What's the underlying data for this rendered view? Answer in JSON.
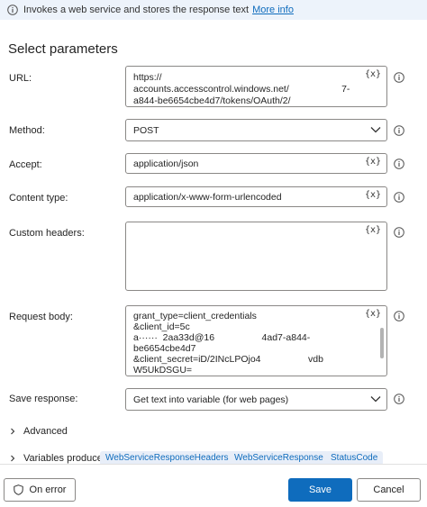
{
  "banner": {
    "text": "Invokes a web service and stores the response text",
    "link": "More info"
  },
  "section_title": "Select parameters",
  "fields": {
    "url": {
      "label": "URL:",
      "lines": [
        "https://",
        "accounts.accesscontrol.windows.net/                    7-",
        "a844-be6654cbe4d7/tokens/OAuth/2/"
      ]
    },
    "method": {
      "label": "Method:",
      "value": "POST"
    },
    "accept": {
      "label": "Accept:",
      "value": "application/json"
    },
    "content_type": {
      "label": "Content type:",
      "value": "application/x-www-form-urlencoded"
    },
    "custom_headers": {
      "label": "Custom headers:",
      "value": ""
    },
    "request_body": {
      "label": "Request body:",
      "lines": [
        "grant_type=client_credentials",
        "&client_id=5c",
        "a······  2aa33d@16                  4ad7-a844-",
        "be6654cbe4d7",
        "&client_secret=iD/2INcLPOjo4                  vdb",
        "W5UkDSGU="
      ]
    },
    "save_response": {
      "label": "Save response:",
      "value": "Get text into variable (for web pages)"
    }
  },
  "fx_symbol": "{x}",
  "advanced": {
    "label": "Advanced"
  },
  "variables_produced": {
    "label": "Variables produced",
    "chips": [
      "WebServiceResponseHeaders",
      "WebServiceResponse",
      "StatusCode"
    ]
  },
  "footer": {
    "on_error": "On error",
    "save": "Save",
    "cancel": "Cancel"
  },
  "colors": {
    "accent": "#0f6cbd",
    "banner_bg": "#edf3fb",
    "chip_bg": "#e8eef8"
  }
}
